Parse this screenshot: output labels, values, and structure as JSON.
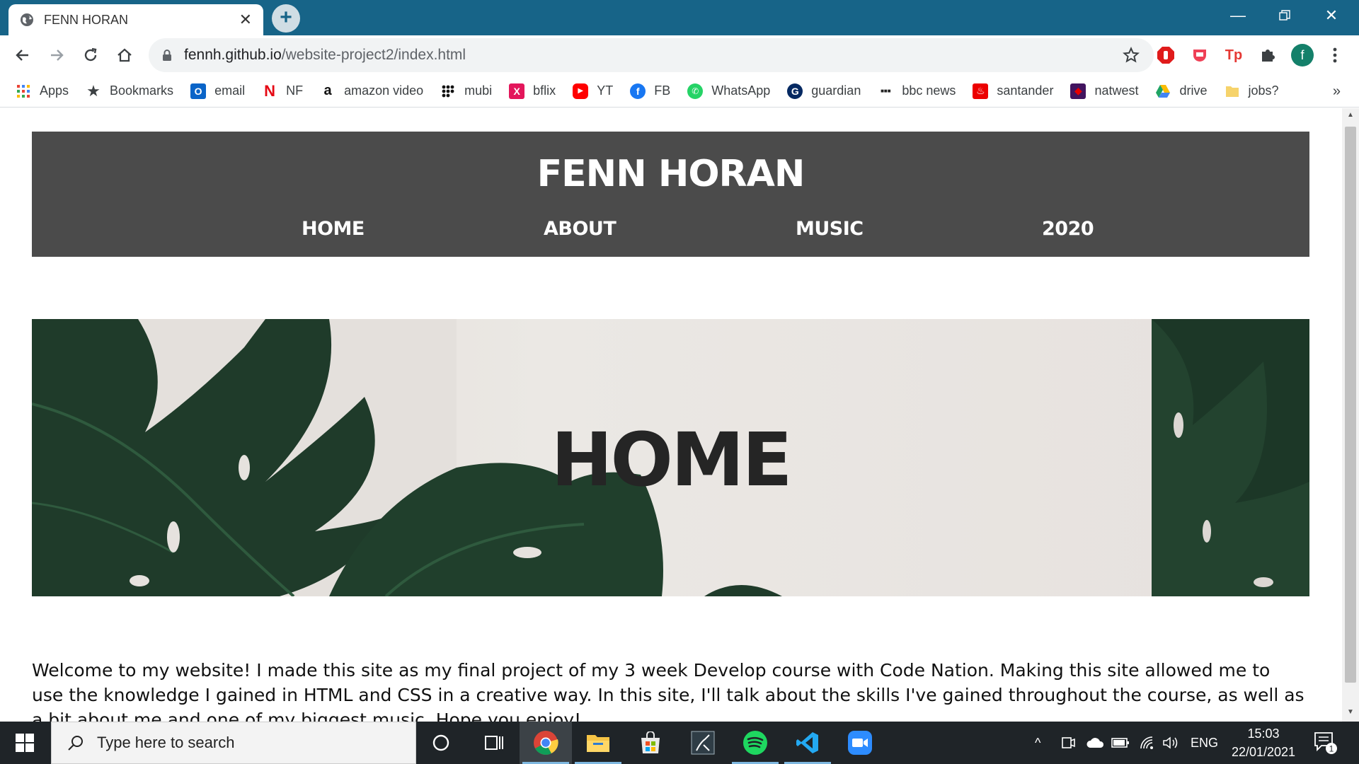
{
  "browser": {
    "tab": {
      "title": "FENN HORAN"
    },
    "url": {
      "host": "fennh.github.io",
      "path": "/website-project2/index.html"
    },
    "profile_initial": "f"
  },
  "bookmarks": [
    {
      "label": "Apps",
      "icon": "apps-grid-icon",
      "color": "#ea4335"
    },
    {
      "label": "Bookmarks",
      "icon": "star-icon",
      "color": "#3c4043"
    },
    {
      "label": "email",
      "icon": "outlook-icon",
      "color": "#0a64c8"
    },
    {
      "label": "NF",
      "icon": "netflix-icon",
      "color": "#e50914"
    },
    {
      "label": "amazon video",
      "icon": "amazon-icon",
      "color": "#111111"
    },
    {
      "label": "mubi",
      "icon": "mubi-icon",
      "color": "#111111"
    },
    {
      "label": "bflix",
      "icon": "bflix-icon",
      "color": "#e3165b"
    },
    {
      "label": "YT",
      "icon": "youtube-icon",
      "color": "#ff0000"
    },
    {
      "label": "FB",
      "icon": "facebook-icon",
      "color": "#1877f2"
    },
    {
      "label": "WhatsApp",
      "icon": "whatsapp-icon",
      "color": "#25d366"
    },
    {
      "label": "guardian",
      "icon": "guardian-icon",
      "color": "#052962"
    },
    {
      "label": "bbc news",
      "icon": "bbc-icon",
      "color": "#222222"
    },
    {
      "label": "santander",
      "icon": "santander-icon",
      "color": "#ec0000"
    },
    {
      "label": "natwest",
      "icon": "natwest-icon",
      "color": "#42145f"
    },
    {
      "label": "drive",
      "icon": "google-drive-icon",
      "color": "#1fa463"
    },
    {
      "label": "jobs?",
      "icon": "folder-icon",
      "color": "#f6d36b"
    }
  ],
  "site": {
    "title": "FENN HORAN",
    "nav": [
      "HOME",
      "ABOUT",
      "MUSIC",
      "2020"
    ],
    "hero_title": "HOME",
    "intro": "Welcome to my website! I made this site as my final project of my 3 week Develop course with Code Nation. Making this site allowed me to use the knowledge I gained in HTML and CSS in a creative way. In this site, I'll talk about the skills I've gained throughout the course, as well as a bit about me and one of my biggest music. Hope you enjoy!"
  },
  "taskbar": {
    "search_placeholder": "Type here to search",
    "language": "ENG",
    "time": "15:03",
    "date": "22/01/2021",
    "notification_count": "1"
  },
  "colors": {
    "tabstrip": "#176488",
    "header_bg": "#4b4b4b",
    "leaf_green": "#1f3b2a"
  }
}
